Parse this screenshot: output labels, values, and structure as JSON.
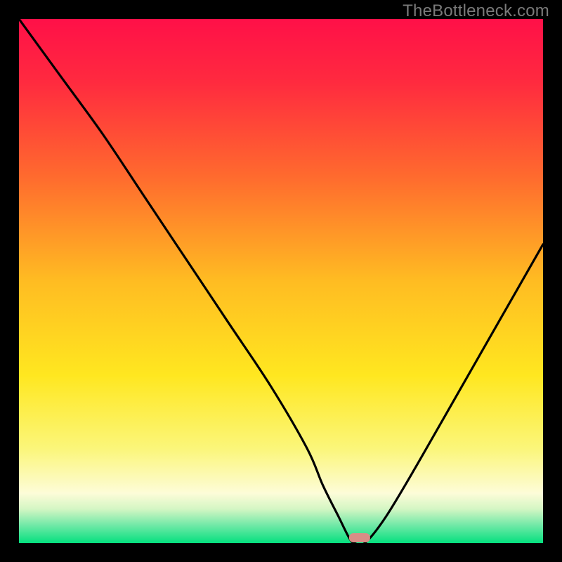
{
  "watermark": "TheBottleneck.com",
  "chart_data": {
    "type": "line",
    "title": "",
    "xlabel": "",
    "ylabel": "",
    "xlim": [
      0,
      100
    ],
    "ylim": [
      0,
      100
    ],
    "x": [
      0,
      8,
      16,
      24,
      32,
      40,
      48,
      55,
      58,
      61,
      63,
      64,
      66,
      70,
      76,
      84,
      92,
      100
    ],
    "values": [
      100,
      89,
      78,
      66,
      54,
      42,
      30,
      18,
      11,
      5,
      1,
      0,
      0,
      5,
      15,
      29,
      43,
      57
    ],
    "marker": {
      "x": 65,
      "y_pct": 0.5
    },
    "gradient_stops": [
      {
        "offset": 0.0,
        "color": "#ff1048"
      },
      {
        "offset": 0.12,
        "color": "#ff2a3f"
      },
      {
        "offset": 0.3,
        "color": "#ff6a2e"
      },
      {
        "offset": 0.5,
        "color": "#ffbc22"
      },
      {
        "offset": 0.68,
        "color": "#ffe720"
      },
      {
        "offset": 0.82,
        "color": "#fbf67a"
      },
      {
        "offset": 0.905,
        "color": "#fdfcd8"
      },
      {
        "offset": 0.935,
        "color": "#d4f6c4"
      },
      {
        "offset": 0.965,
        "color": "#74e9a8"
      },
      {
        "offset": 1.0,
        "color": "#05e07f"
      }
    ]
  }
}
